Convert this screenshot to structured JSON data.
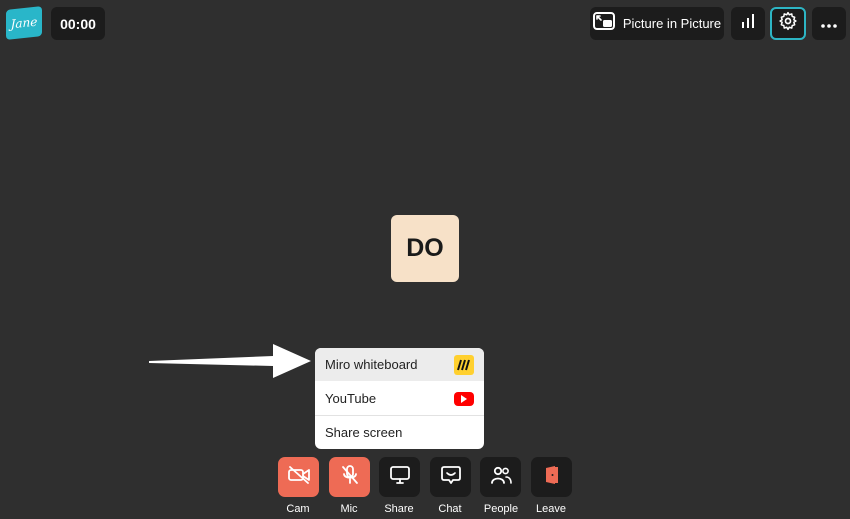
{
  "logo": {
    "text": "Jane",
    "color": "#29b6c9"
  },
  "timer": {
    "value": "00:00"
  },
  "topbar": {
    "pip_label": "Picture in Picture",
    "pip_icon": "picture-in-picture-icon",
    "stats_icon": "bar-chart-icon",
    "settings_icon": "gear-icon",
    "more_icon": "more-horizontal-icon"
  },
  "participant": {
    "initials": "DO",
    "tile_color": "#f7e1c8"
  },
  "share_menu": {
    "items": [
      {
        "label": "Miro whiteboard",
        "icon": "miro-icon",
        "highlighted": true
      },
      {
        "label": "YouTube",
        "icon": "youtube-icon",
        "highlighted": false
      },
      {
        "label": "Share screen",
        "icon": "",
        "highlighted": false
      }
    ]
  },
  "controls": [
    {
      "label": "Cam",
      "icon": "camera-off-icon",
      "state": "off"
    },
    {
      "label": "Mic",
      "icon": "mic-off-icon",
      "state": "off"
    },
    {
      "label": "Share",
      "icon": "monitor-icon",
      "state": "on"
    },
    {
      "label": "Chat",
      "icon": "chat-icon",
      "state": "on"
    },
    {
      "label": "People",
      "icon": "people-icon",
      "state": "on"
    },
    {
      "label": "Leave",
      "icon": "leave-door-icon",
      "state": "on"
    }
  ],
  "colors": {
    "background": "#2f2f2f",
    "button_dark": "#1c1c1c",
    "muted_red": "#ee6b55",
    "accent": "#2db5c4"
  }
}
